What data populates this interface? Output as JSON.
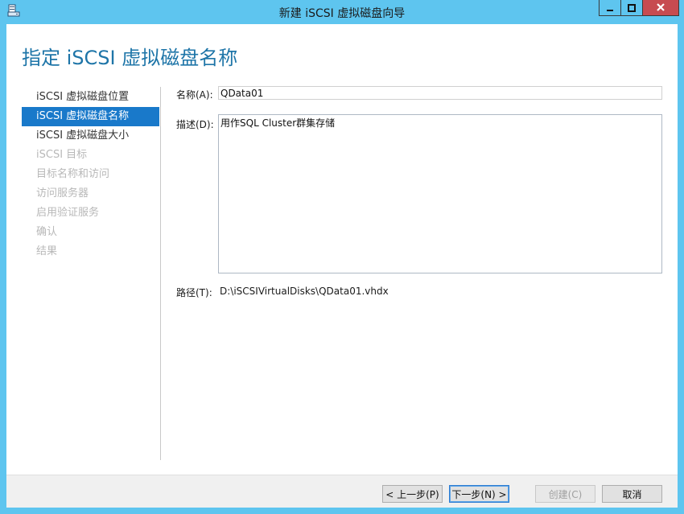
{
  "window": {
    "title": "新建 iSCSI 虚拟磁盘向导"
  },
  "heading": "指定 iSCSI 虚拟磁盘名称",
  "nav": {
    "items": [
      {
        "label": "iSCSI 虚拟磁盘位置",
        "state": "normal"
      },
      {
        "label": "iSCSI 虚拟磁盘名称",
        "state": "active"
      },
      {
        "label": "iSCSI 虚拟磁盘大小",
        "state": "normal"
      },
      {
        "label": "iSCSI 目标",
        "state": "disabled"
      },
      {
        "label": "目标名称和访问",
        "state": "disabled"
      },
      {
        "label": "访问服务器",
        "state": "disabled"
      },
      {
        "label": "启用验证服务",
        "state": "disabled"
      },
      {
        "label": "确认",
        "state": "disabled"
      },
      {
        "label": "结果",
        "state": "disabled"
      }
    ]
  },
  "form": {
    "name_label": "名称(A):",
    "name_value": "QData01",
    "description_label": "描述(D):",
    "description_value": "用作SQL Cluster群集存储",
    "path_label": "路径(T):",
    "path_value": "D:\\iSCSIVirtualDisks\\QData01.vhdx"
  },
  "footer": {
    "back_label": "< 上一步(P)",
    "next_label": "下一步(N) >",
    "create_label": "创建(C)",
    "cancel_label": "取消"
  },
  "colors": {
    "titlebar": "#5ec5ef",
    "heading": "#1e75a8",
    "nav_active": "#1979ca",
    "close_button": "#c74b50"
  },
  "icons": {
    "app": "wizard-disk-icon",
    "minimize": "minimize-icon",
    "maximize": "maximize-icon",
    "close": "close-icon"
  }
}
